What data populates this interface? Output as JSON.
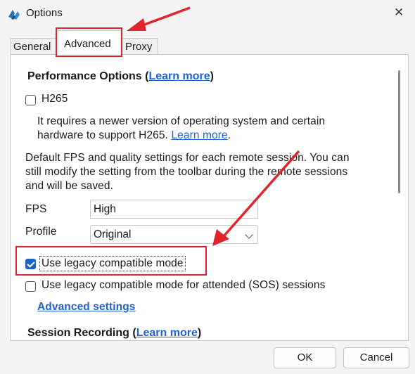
{
  "window": {
    "title": "Options",
    "close_symbol": "✕",
    "icon": "app-logo-icon"
  },
  "tabs": [
    {
      "label": "General"
    },
    {
      "label": "Advanced"
    },
    {
      "label": "Proxy"
    }
  ],
  "performance": {
    "title": "Performance Options (",
    "learn_more": "Learn more",
    "title_end": ")",
    "h265_label": "H265",
    "h265_checked": false,
    "h265_desc_line1": "It requires a newer version of operating system and certain",
    "h265_desc_line2_prefix": "hardware to support H265. ",
    "h265_desc_link": "Learn more",
    "h265_desc_suffix": ".",
    "fps_desc_line1": "Default FPS and quality settings for each remote session. You can",
    "fps_desc_line2": "still modify the setting from the toolbar during the remote sessions",
    "fps_desc_line3": "and will be saved.",
    "fps_label": "FPS",
    "fps_value": "High",
    "profile_label": "Profile",
    "profile_value": "Original",
    "legacy_label": "Use legacy compatible mode",
    "legacy_checked": true,
    "legacy_sos_label": "Use legacy compatible mode for attended (SOS) sessions",
    "legacy_sos_checked": false,
    "advanced_settings": "Advanced settings"
  },
  "recording": {
    "title": "Session Recording (",
    "learn_more": "Learn more",
    "title_end": ")"
  },
  "buttons": {
    "ok": "OK",
    "cancel": "Cancel"
  },
  "colors": {
    "annotation": "#e0242b",
    "link": "#1f62d8",
    "checkbox_accent": "#1a64c6"
  }
}
